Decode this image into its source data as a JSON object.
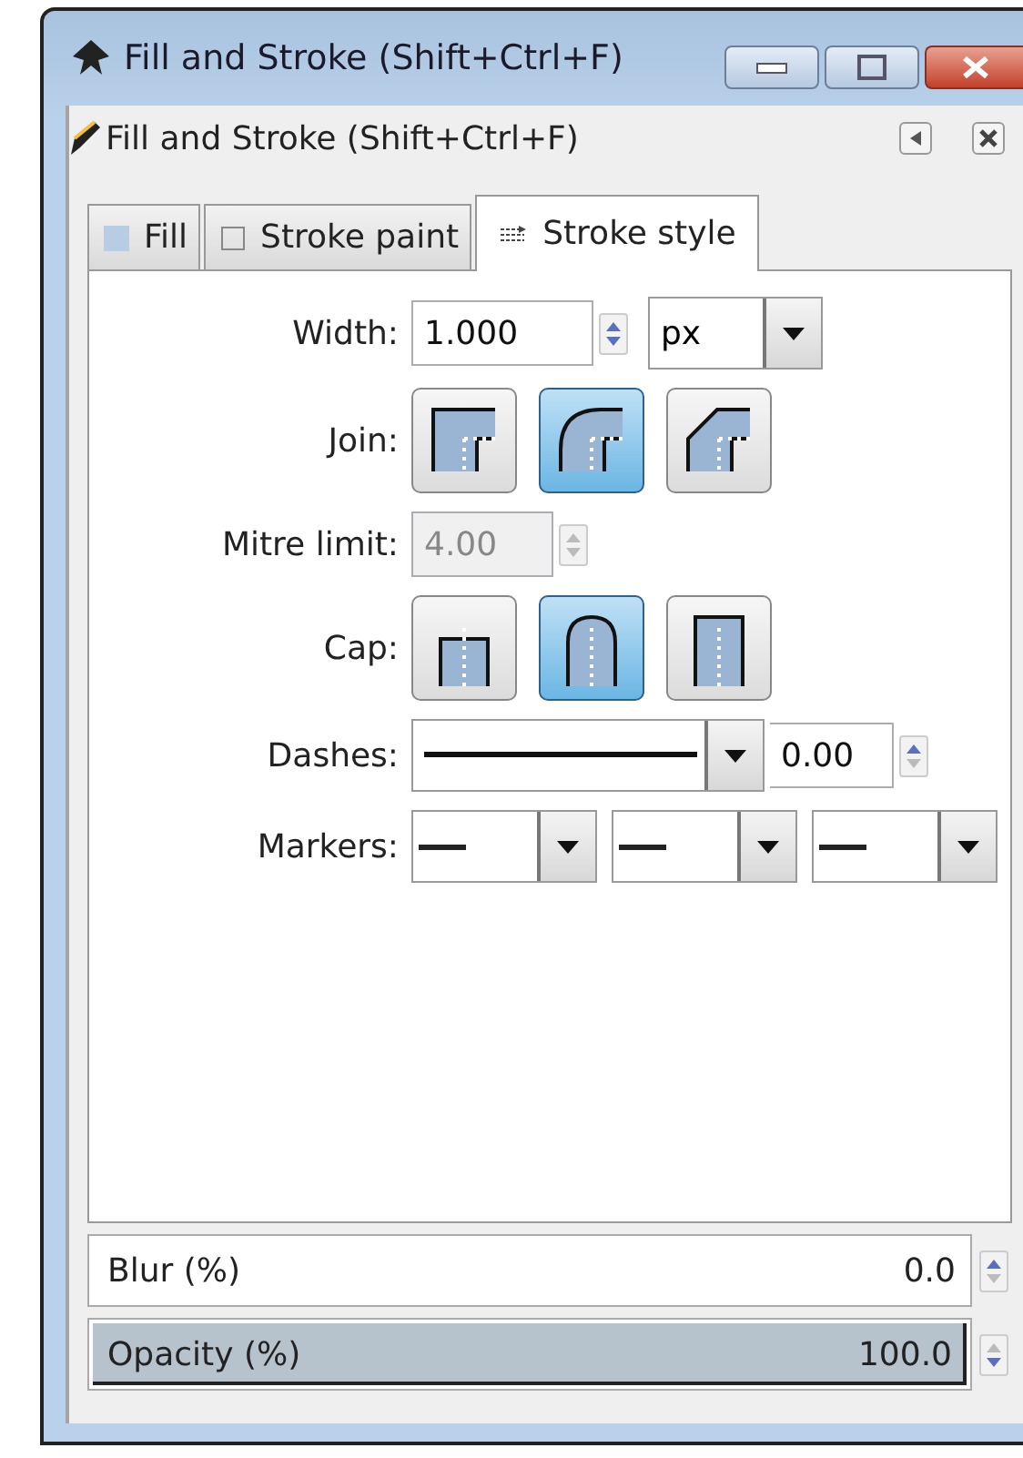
{
  "window": {
    "title": "Fill and Stroke (Shift+Ctrl+F)"
  },
  "panel": {
    "title": "Fill and Stroke (Shift+Ctrl+F)"
  },
  "tabs": [
    {
      "label": "Fill",
      "kind": "fill",
      "selected": false
    },
    {
      "label": "Stroke paint",
      "kind": "paint",
      "selected": false
    },
    {
      "label": "Stroke style",
      "kind": "style",
      "selected": true
    }
  ],
  "width": {
    "label": "Width:",
    "value": "1.000",
    "unit": "px"
  },
  "join": {
    "label": "Join:",
    "options": [
      {
        "kind": "miter",
        "selected": false
      },
      {
        "kind": "round",
        "selected": true
      },
      {
        "kind": "bevel",
        "selected": false
      }
    ]
  },
  "mitre_limit": {
    "label": "Mitre limit:",
    "value": "4.00",
    "disabled": true
  },
  "cap": {
    "label": "Cap:",
    "options": [
      {
        "kind": "butt",
        "selected": false
      },
      {
        "kind": "round",
        "selected": true
      },
      {
        "kind": "square",
        "selected": false
      }
    ]
  },
  "dashes": {
    "label": "Dashes:",
    "value": "0.00"
  },
  "markers": {
    "label": "Markers:",
    "slots": [
      {
        "kind": "none"
      },
      {
        "kind": "none"
      },
      {
        "kind": "none"
      }
    ]
  },
  "blur": {
    "label": "Blur (%)",
    "value": "0.0"
  },
  "opacity": {
    "label": "Opacity (%)",
    "value": "100.0",
    "level": 1
  }
}
